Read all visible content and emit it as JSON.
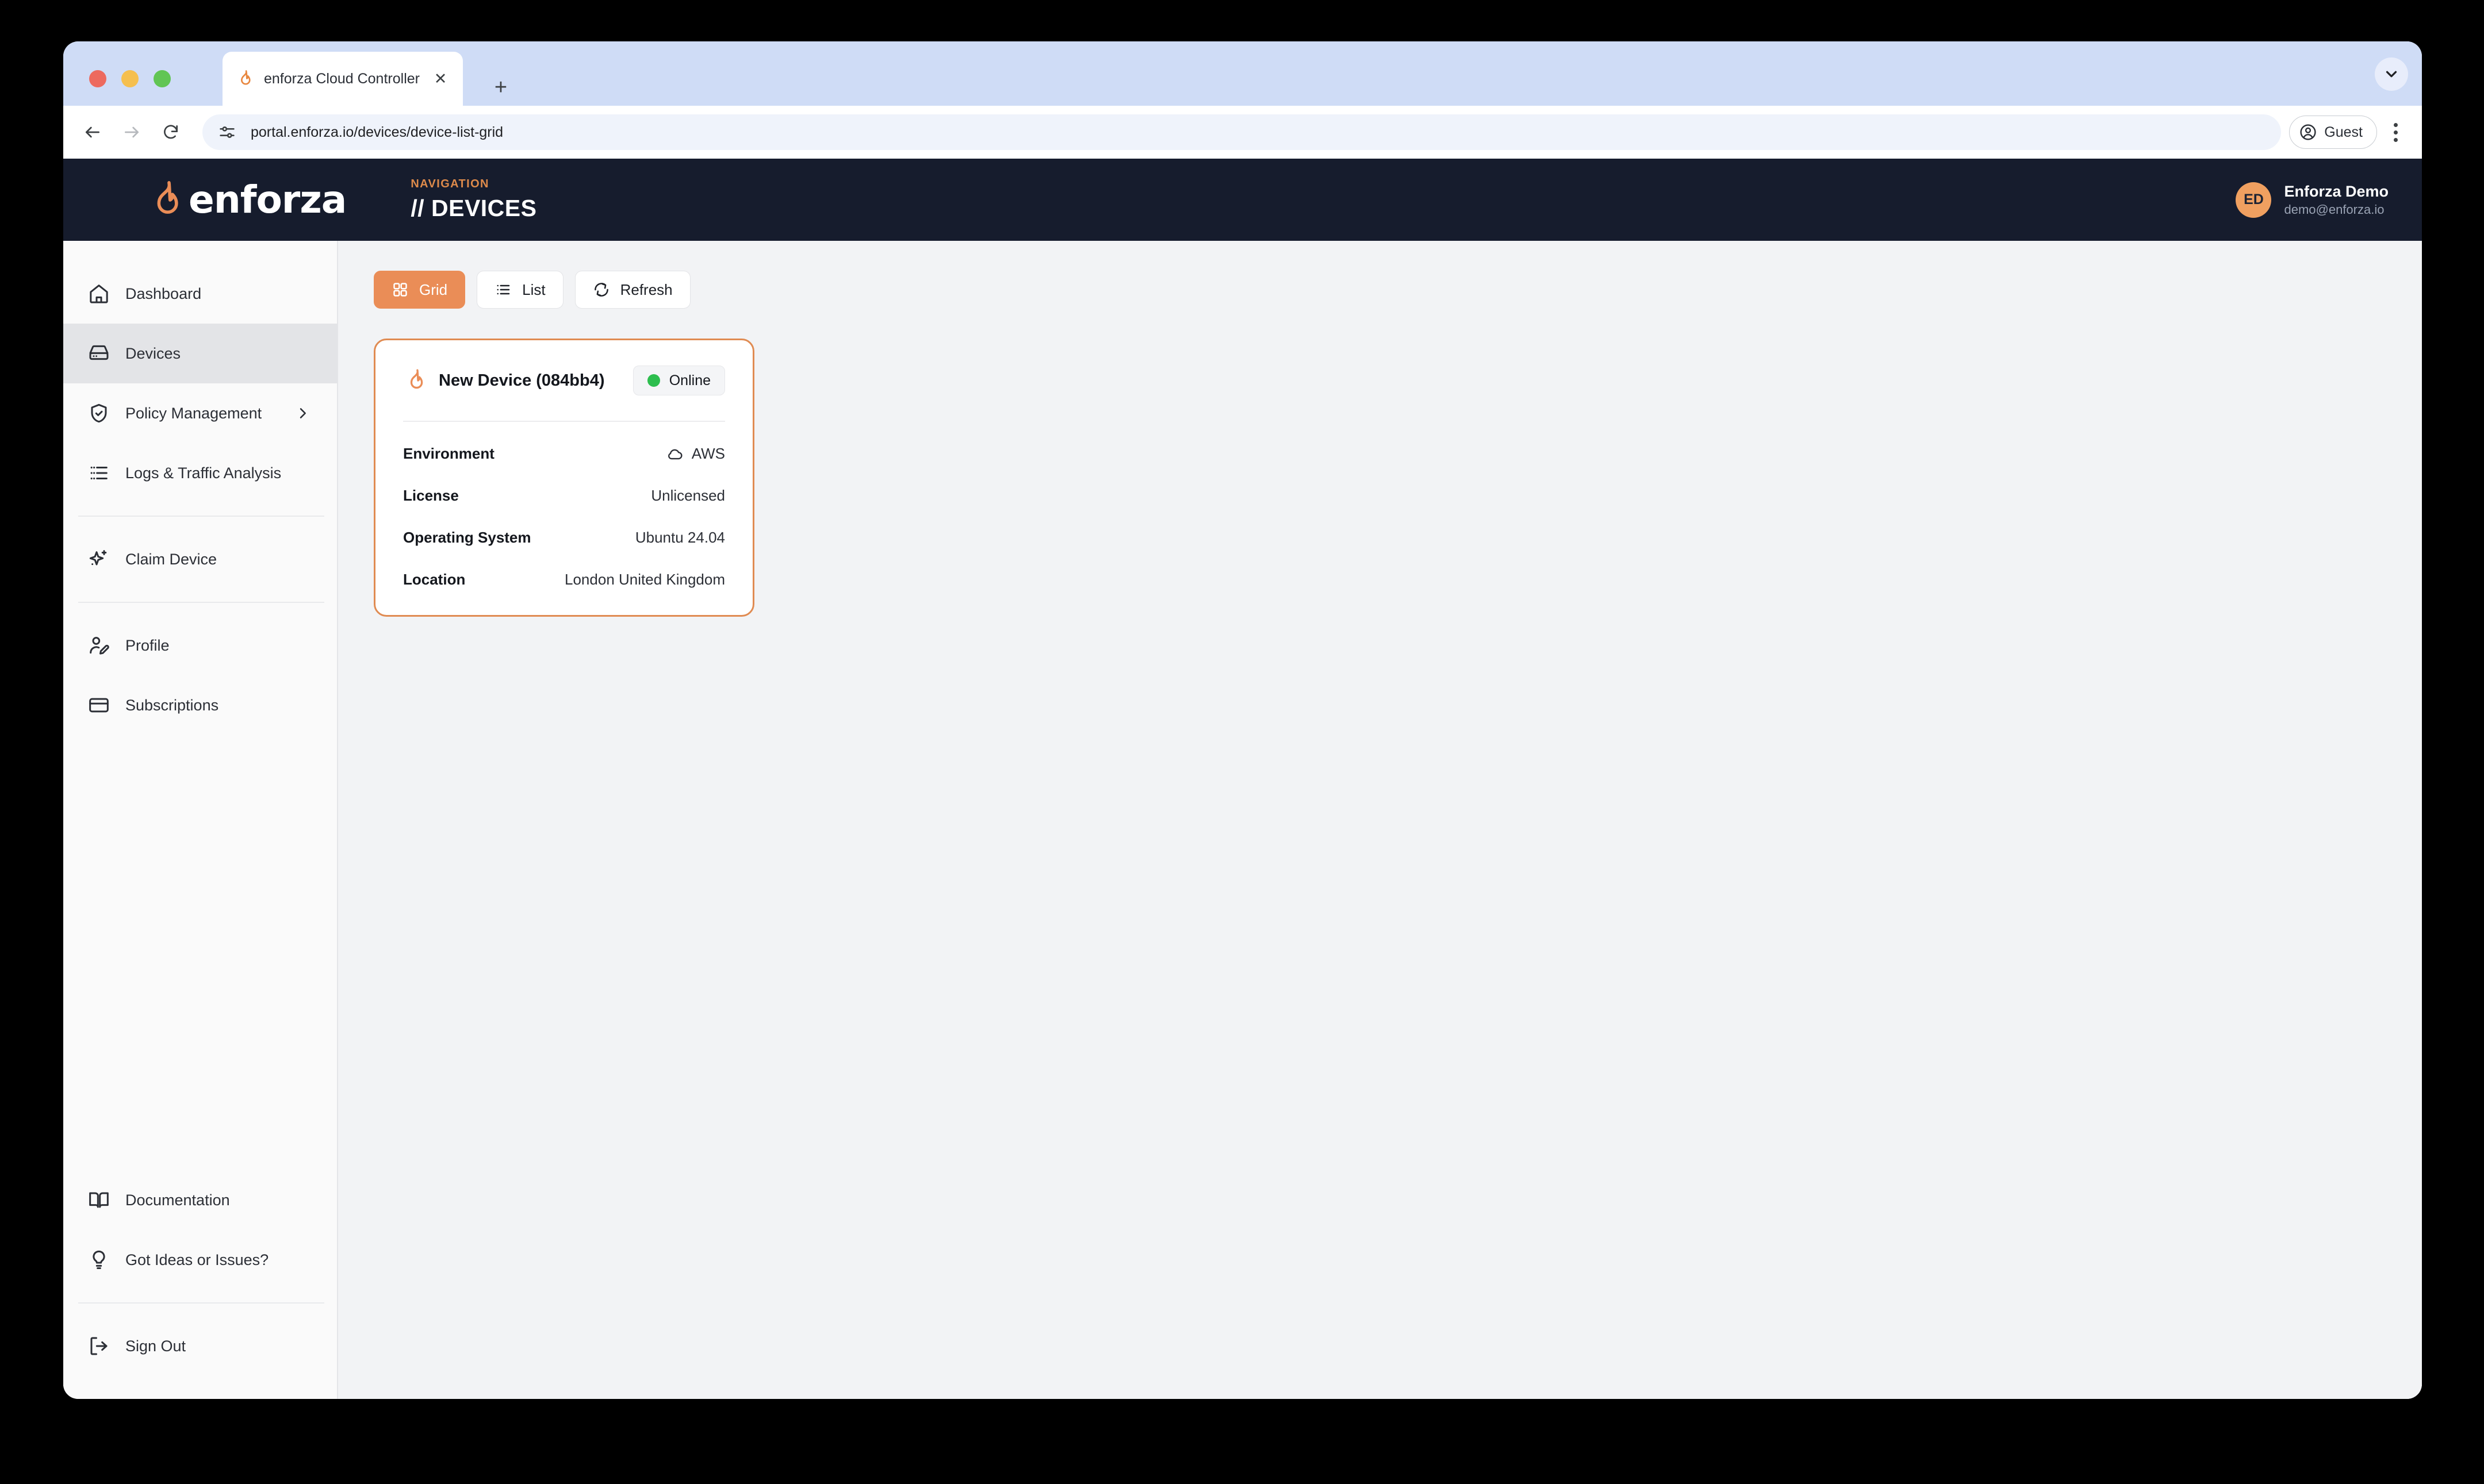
{
  "browser": {
    "tab": {
      "title": "enforza Cloud Controller",
      "favicon_icon": "flame-icon",
      "close_icon": "close-icon"
    },
    "new_tab_icon": "plus-icon",
    "tab_list_icon": "chevron-down-icon",
    "back_icon": "arrow-left-icon",
    "forward_icon": "arrow-right-icon",
    "reload_icon": "reload-icon",
    "omnibox": {
      "url": "portal.enforza.io/devices/device-list-grid",
      "site_info_icon": "tune-icon"
    },
    "profile": {
      "label": "Guest",
      "icon": "account-circle-icon"
    },
    "menu_icon": "more-vertical-icon"
  },
  "header": {
    "brand": {
      "logo_icon": "flame-icon",
      "wordmark": "enforza"
    },
    "nav_kicker": "NAVIGATION",
    "nav_title": "// DEVICES",
    "user": {
      "initials": "ED",
      "name": "Enforza Demo",
      "email": "demo@enforza.io"
    }
  },
  "sidebar": {
    "primary_items": [
      {
        "label": "Dashboard",
        "icon": "home-icon",
        "active": false,
        "chevron": false
      },
      {
        "label": "Devices",
        "icon": "server-icon",
        "active": true,
        "chevron": false
      },
      {
        "label": "Policy Management",
        "icon": "shield-check-icon",
        "active": false,
        "chevron": true
      },
      {
        "label": "Logs & Traffic Analysis",
        "icon": "list-detail-icon",
        "active": false,
        "chevron": false
      }
    ],
    "secondary_items": [
      {
        "label": "Claim Device",
        "icon": "sparkles-icon",
        "active": false,
        "chevron": false
      }
    ],
    "account_items": [
      {
        "label": "Profile",
        "icon": "user-edit-icon",
        "active": false,
        "chevron": false
      },
      {
        "label": "Subscriptions",
        "icon": "credit-card-icon",
        "active": false,
        "chevron": false
      }
    ],
    "support_items": [
      {
        "label": "Documentation",
        "icon": "book-icon",
        "active": false,
        "chevron": false
      },
      {
        "label": "Got Ideas or Issues?",
        "icon": "lightbulb-icon",
        "active": false,
        "chevron": false
      }
    ],
    "footer_items": [
      {
        "label": "Sign Out",
        "icon": "logout-icon",
        "active": false,
        "chevron": false
      }
    ]
  },
  "main": {
    "view_toolbar": [
      {
        "label": "Grid",
        "icon": "grid-icon",
        "active": true
      },
      {
        "label": "List",
        "icon": "list-icon",
        "active": false
      },
      {
        "label": "Refresh",
        "icon": "refresh-icon",
        "active": false
      }
    ],
    "devices": [
      {
        "title": "New Device (084bb4)",
        "title_icon": "flame-icon",
        "status": {
          "label": "Online",
          "color": "#2dbe4e"
        },
        "specs": [
          {
            "label": "Environment",
            "value": "AWS",
            "icon": "cloud-icon"
          },
          {
            "label": "License",
            "value": "Unlicensed",
            "icon": null
          },
          {
            "label": "Operating System",
            "value": "Ubuntu 24.04",
            "icon": null
          },
          {
            "label": "Location",
            "value": "London United Kingdom",
            "icon": null
          }
        ]
      }
    ]
  },
  "colors": {
    "brand_orange": "#ea8d57",
    "header_navy": "#161c2d",
    "accent_kicker": "#dd8a4b",
    "status_online": "#2dbe4e",
    "card_border": "#e08b52"
  }
}
